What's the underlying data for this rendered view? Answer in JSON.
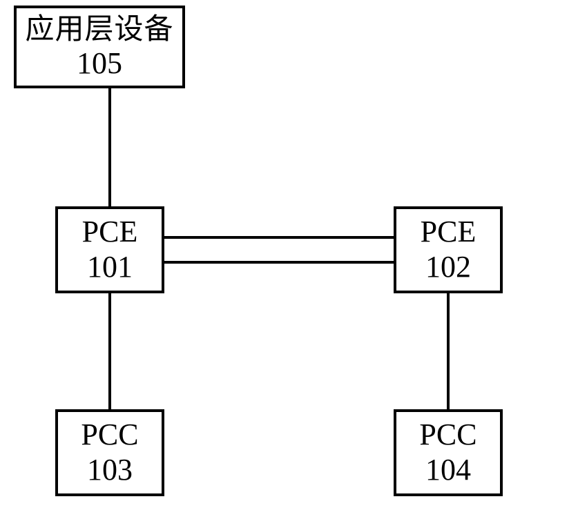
{
  "nodes": {
    "app_layer": {
      "label": "应用层设备",
      "id": "105"
    },
    "pce_left": {
      "label": "PCE",
      "id": "101"
    },
    "pce_right": {
      "label": "PCE",
      "id": "102"
    },
    "pcc_left": {
      "label": "PCC",
      "id": "103"
    },
    "pcc_right": {
      "label": "PCC",
      "id": "104"
    }
  }
}
